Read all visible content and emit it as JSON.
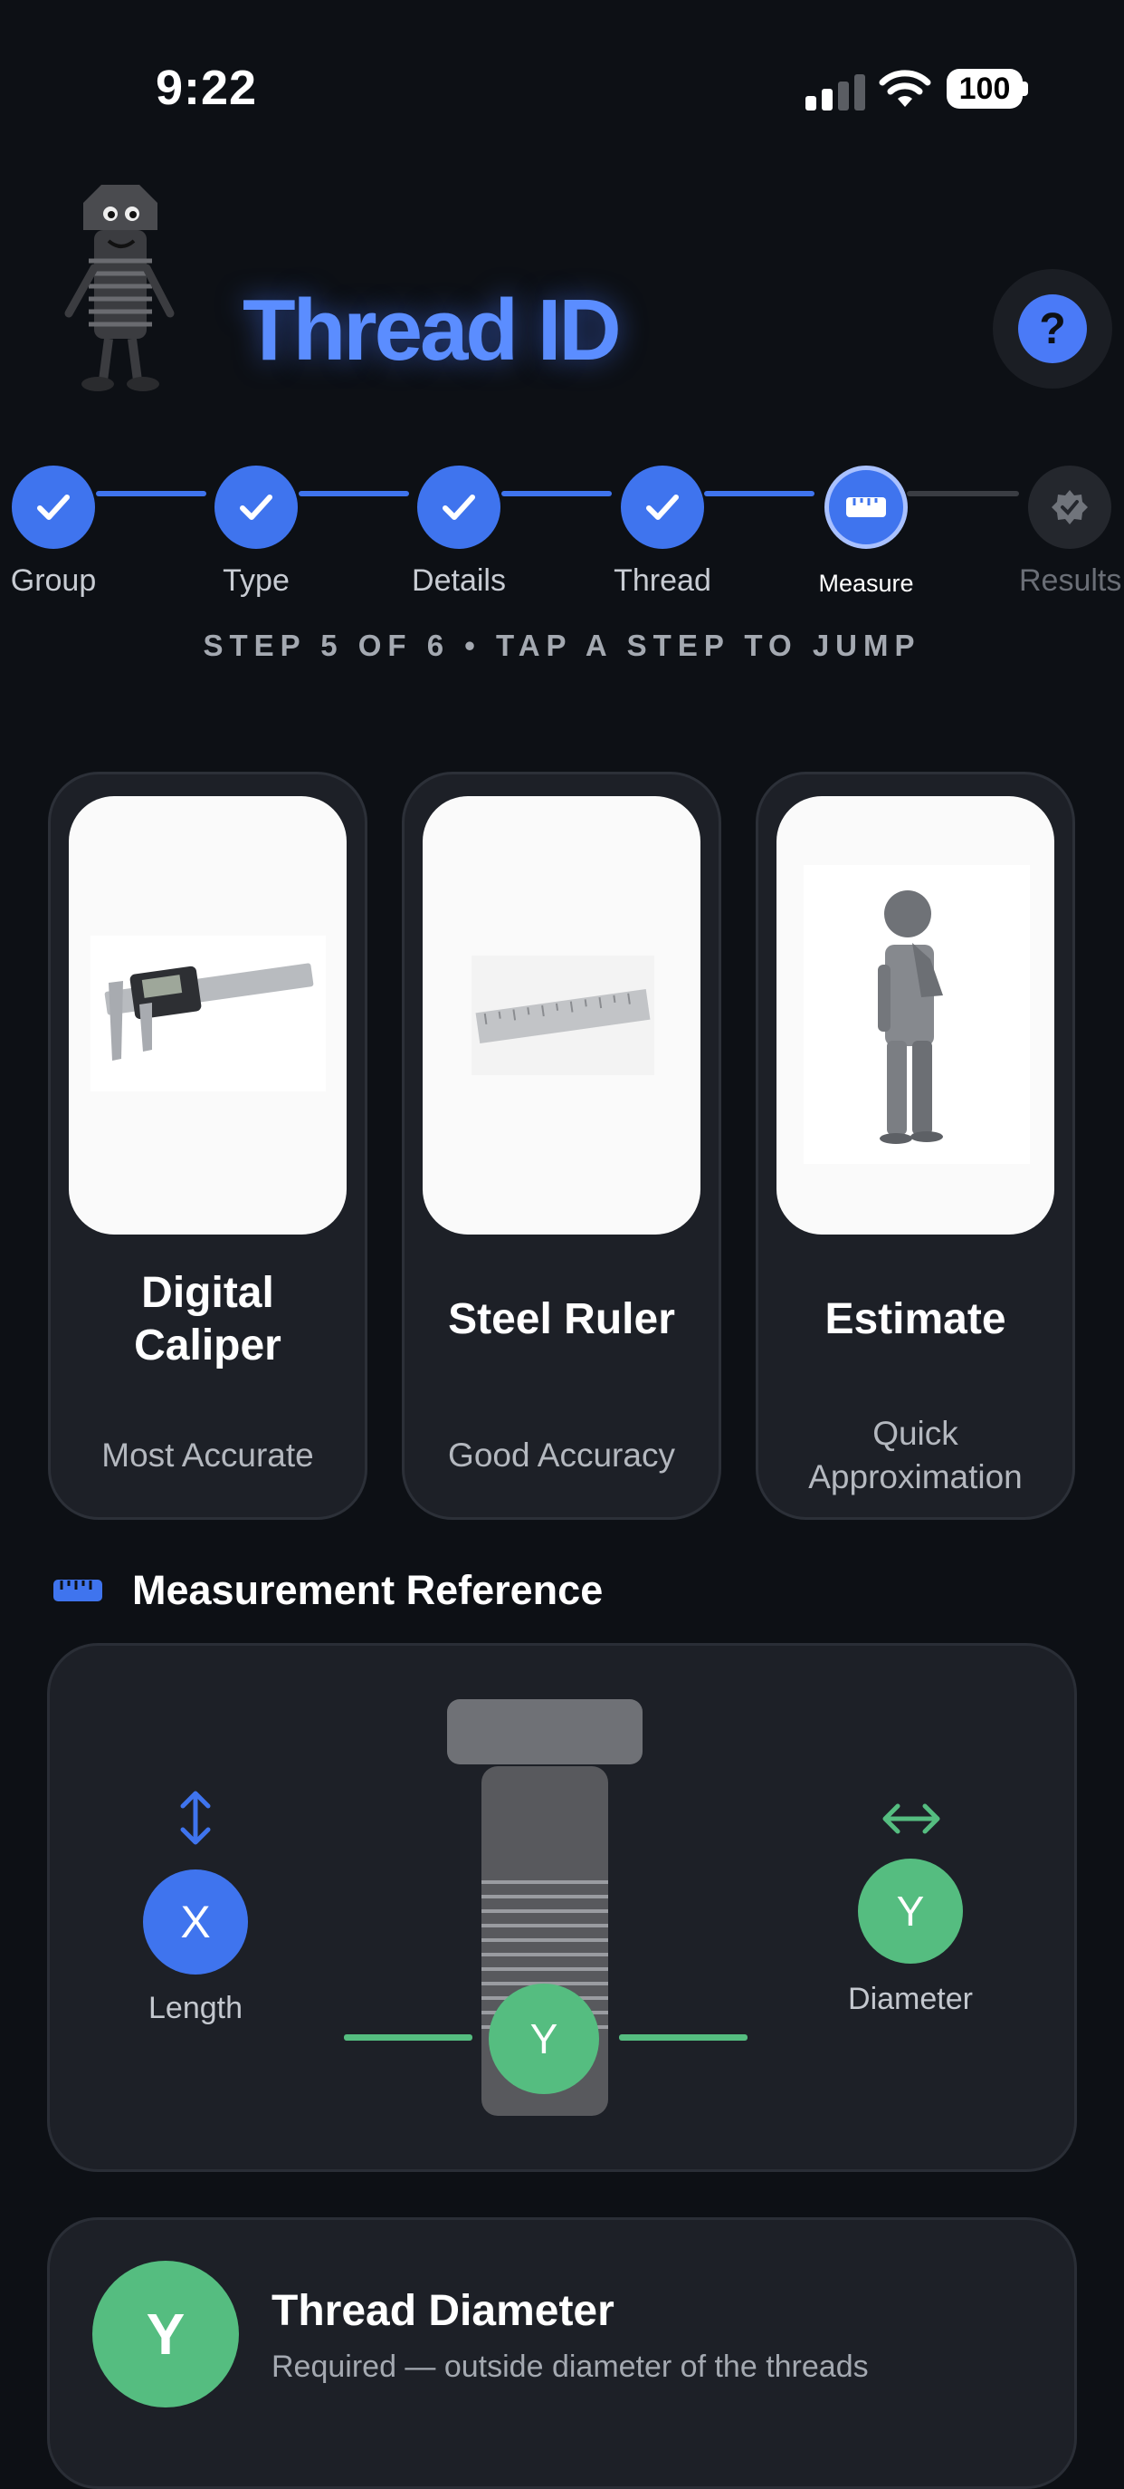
{
  "status_bar": {
    "time": "9:22",
    "battery": "100"
  },
  "header": {
    "title": "Thread ID",
    "help_label": "?",
    "mascot_icon": "bolt-mascot-icon"
  },
  "stepper": {
    "steps": [
      {
        "label": "Group",
        "state": "done"
      },
      {
        "label": "Type",
        "state": "done"
      },
      {
        "label": "Details",
        "state": "done"
      },
      {
        "label": "Thread",
        "state": "done"
      },
      {
        "label": "Measure",
        "state": "current"
      },
      {
        "label": "Results",
        "state": "pending"
      }
    ],
    "caption": "STEP 5 OF 6 • TAP A STEP TO JUMP"
  },
  "methods": [
    {
      "title_line1": "Digital",
      "title_line2": "Caliper",
      "subtitle_line1": "Most Accurate",
      "subtitle_line2": "",
      "image": "digital-caliper-image"
    },
    {
      "title_line1": "Steel Ruler",
      "title_line2": "",
      "subtitle_line1": "Good Accuracy",
      "subtitle_line2": "",
      "image": "steel-ruler-image"
    },
    {
      "title_line1": "Estimate",
      "title_line2": "",
      "subtitle_line1": "Quick",
      "subtitle_line2": "Approximation",
      "image": "thinking-figure-image"
    }
  ],
  "reference": {
    "title": "Measurement Reference",
    "length_badge": "X",
    "length_label": "Length",
    "diameter_badge": "Y",
    "diameter_label": "Diameter",
    "bolt_badge": "Y"
  },
  "thread_diameter": {
    "badge": "Y",
    "title": "Thread Diameter",
    "subtitle": "Required — outside diameter of the threads"
  },
  "colors": {
    "accent": "#3f74ee",
    "green": "#55bd80",
    "background": "#0d1015",
    "card": "#1d2027"
  }
}
